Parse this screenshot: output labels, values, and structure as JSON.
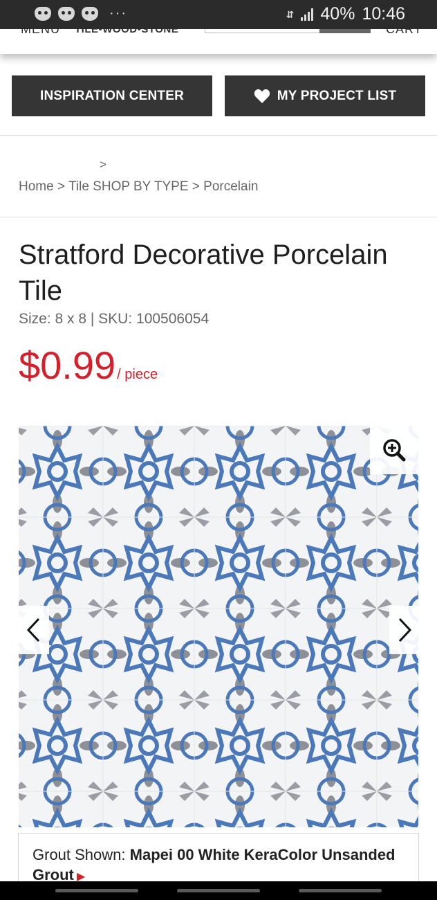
{
  "status_bar": {
    "icons": [
      "game-controller-icon",
      "game-controller-icon",
      "game-controller-icon",
      "more-dots-icon"
    ],
    "more": "···",
    "data_icon": "LTE",
    "battery": "40%",
    "time": "10:46"
  },
  "site_header": {
    "menu_label": "MENU",
    "logo_text": "TILE•WOOD•STONE",
    "cart_label": "CART"
  },
  "actions": {
    "inspiration_label": "INSPIRATION CENTER",
    "project_list_label": "MY PROJECT LIST",
    "project_list_icon": "heart-icon"
  },
  "breadcrumb": {
    "separator_top": ">",
    "text": "Home > Tile SHOP BY TYPE > Porcelain"
  },
  "product": {
    "title": "Stratford Decorative Porcelain Tile",
    "meta": "Size: 8 x 8   | SKU: 100506054",
    "price": "$0.99",
    "price_unit": "/ piece",
    "colors": {
      "price": "#d3202b",
      "tile_blue": "#4b78b8",
      "tile_gray": "#8d9096"
    }
  },
  "gallery": {
    "zoom_icon": "zoom-in-icon",
    "prev_icon": "chevron-left-icon",
    "next_icon": "chevron-right-icon"
  },
  "grout": {
    "label": "Grout Shown: ",
    "name": "Mapei 00 White KeraColor Unsanded Grout",
    "arrow": "▶"
  }
}
